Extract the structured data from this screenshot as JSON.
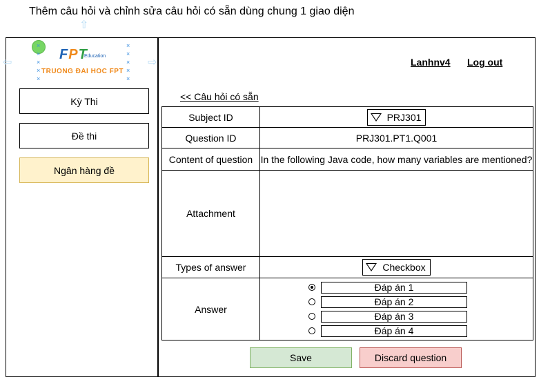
{
  "caption": "Thêm câu hỏi và chỉnh sửa câu hỏi có sẵn dùng chung 1 giao diện",
  "logo": {
    "brand_f": "F",
    "brand_p": "P",
    "brand_t": "T",
    "sub": "Education",
    "school": "TRUONG ĐAI HOC FPT"
  },
  "sidebar": {
    "items": [
      {
        "label": "Kỳ Thi"
      },
      {
        "label": "Đề thi"
      },
      {
        "label": "Ngân hàng đề"
      }
    ]
  },
  "header": {
    "user": "Lanhnv4",
    "logout": "Log out"
  },
  "back_link": "<< Câu hỏi có sẵn",
  "form": {
    "subject_label": "Subject ID",
    "subject_value": "PRJ301",
    "question_label": "Question ID",
    "question_value": "PRJ301.PT1.Q001",
    "content_label": "Content of question",
    "content_value": "In the following Java code, how many variables are mentioned?",
    "attachment_label": "Attachment",
    "types_label": "Types of answer",
    "types_value": "Checkbox",
    "answer_label": "Answer",
    "answers": [
      {
        "label": "Đáp án 1",
        "selected": true
      },
      {
        "label": "Đáp án 2",
        "selected": false
      },
      {
        "label": "Đáp án 3",
        "selected": false
      },
      {
        "label": "Đáp án 4",
        "selected": false
      }
    ]
  },
  "buttons": {
    "save": "Save",
    "discard": "Discard question"
  },
  "colors": {
    "active_tab_bg": "#fff2cc",
    "save_bg": "#d5e8d4",
    "discard_bg": "#f8cecc"
  }
}
